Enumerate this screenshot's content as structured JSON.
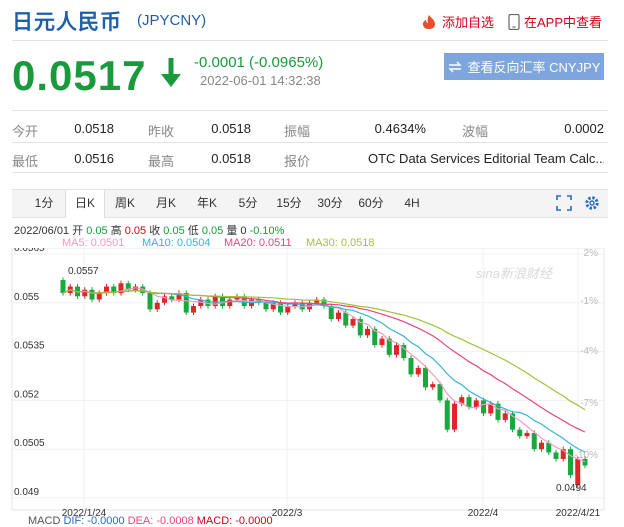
{
  "header": {
    "title": "日元人民币",
    "code": "(JPYCNY)",
    "favorite_label": "添加自选",
    "app_label": "在APP中查看"
  },
  "quote": {
    "price": "0.0517",
    "change": "-0.0001 (-0.0965%)",
    "datetime": "2022-06-01 14:32:38",
    "reverse_button": "查看反向汇率 CNYJPY"
  },
  "stats": [
    {
      "label": "今开",
      "value": "0.0518"
    },
    {
      "label": "昨收",
      "value": "0.0518"
    },
    {
      "label": "振幅",
      "value": "0.4634%"
    },
    {
      "label": "波幅",
      "value": "0.0002"
    },
    {
      "label": "最低",
      "value": "0.0516"
    },
    {
      "label": "最高",
      "value": "0.0518"
    },
    {
      "label": "报价",
      "value": "OTC Data Services Editorial Team Calc..."
    }
  ],
  "tabs": [
    "1分",
    "日K",
    "周K",
    "月K",
    "年K",
    "5分",
    "15分",
    "30分",
    "60分",
    "4H"
  ],
  "active_tab": "日K",
  "bar_info": {
    "date": "2022/06/01",
    "open_label": "开",
    "open": "0.05",
    "high_label": "高",
    "high": "0.05",
    "close_label": "收",
    "close": "0.05",
    "low_label": "低",
    "low": "0.05",
    "volume_label": "量",
    "volume": "0",
    "pct": "-0.10%"
  },
  "ma_legend": [
    {
      "label": "MA5: 0.0501",
      "color": "#f29ac3"
    },
    {
      "label": "MA10: 0.0504",
      "color": "#3ab3d9"
    },
    {
      "label": "MA20: 0.0511",
      "color": "#e6467d"
    },
    {
      "label": "MA30: 0.0518",
      "color": "#a3c23c"
    }
  ],
  "chart_data": {
    "type": "candlestick",
    "y_left_ticks": [
      "0.0565",
      "0.055",
      "0.0535",
      "0.052",
      "0.0505",
      "0.049"
    ],
    "y_right_ticks": [
      "2%",
      "-1%",
      "-4%",
      "-7%",
      "-10%"
    ],
    "x_ticks": [
      "2022/1/24",
      "2022/3",
      "2022/4",
      "2022/4/21"
    ],
    "ylim": [
      0.049,
      0.0565
    ],
    "max_label": "0.0557",
    "min_label": "0.0494",
    "watermark": "sina新浪财经",
    "colors": {
      "up": "#e0262a",
      "down": "#19a83e"
    },
    "candles": [
      [
        0.0557,
        0.0553
      ],
      [
        0.0553,
        0.0555
      ],
      [
        0.0555,
        0.0552
      ],
      [
        0.0552,
        0.0554
      ],
      [
        0.0554,
        0.0551
      ],
      [
        0.0551,
        0.0553
      ],
      [
        0.0553,
        0.0555
      ],
      [
        0.0555,
        0.0553
      ],
      [
        0.0553,
        0.0556
      ],
      [
        0.0556,
        0.0554
      ],
      [
        0.0554,
        0.0555
      ],
      [
        0.0555,
        0.0553
      ],
      [
        0.0553,
        0.0548
      ],
      [
        0.0548,
        0.055
      ],
      [
        0.055,
        0.0552
      ],
      [
        0.0552,
        0.0551
      ],
      [
        0.0551,
        0.0553
      ],
      [
        0.0553,
        0.0547
      ],
      [
        0.0547,
        0.0549
      ],
      [
        0.0549,
        0.0551
      ],
      [
        0.0551,
        0.0549
      ],
      [
        0.0549,
        0.0552
      ],
      [
        0.0552,
        0.0549
      ],
      [
        0.0549,
        0.0551
      ],
      [
        0.0551,
        0.0552
      ],
      [
        0.0552,
        0.0549
      ],
      [
        0.0549,
        0.0551
      ],
      [
        0.0551,
        0.055
      ],
      [
        0.055,
        0.0548
      ],
      [
        0.0548,
        0.055
      ],
      [
        0.055,
        0.0547
      ],
      [
        0.0547,
        0.0549
      ],
      [
        0.0549,
        0.055
      ],
      [
        0.055,
        0.0548
      ],
      [
        0.0548,
        0.055
      ],
      [
        0.055,
        0.0551
      ],
      [
        0.0551,
        0.0549
      ],
      [
        0.0549,
        0.0545
      ],
      [
        0.0545,
        0.0547
      ],
      [
        0.0547,
        0.0543
      ],
      [
        0.0543,
        0.0545
      ],
      [
        0.0545,
        0.054
      ],
      [
        0.054,
        0.0542
      ],
      [
        0.0542,
        0.0537
      ],
      [
        0.0537,
        0.0539
      ],
      [
        0.0539,
        0.0534
      ],
      [
        0.0534,
        0.0537
      ],
      [
        0.0537,
        0.0533
      ],
      [
        0.0533,
        0.0528
      ],
      [
        0.0528,
        0.053
      ],
      [
        0.053,
        0.0524
      ],
      [
        0.0524,
        0.0525
      ],
      [
        0.0525,
        0.052
      ],
      [
        0.052,
        0.0511
      ],
      [
        0.0511,
        0.0519
      ],
      [
        0.0519,
        0.0521
      ],
      [
        0.0521,
        0.0518
      ],
      [
        0.0518,
        0.052
      ],
      [
        0.052,
        0.0516
      ],
      [
        0.0516,
        0.0519
      ],
      [
        0.0519,
        0.0514
      ],
      [
        0.0514,
        0.0516
      ],
      [
        0.0516,
        0.0511
      ],
      [
        0.0511,
        0.0509
      ],
      [
        0.0509,
        0.051
      ],
      [
        0.051,
        0.0505
      ],
      [
        0.0505,
        0.0507
      ],
      [
        0.0507,
        0.0504
      ],
      [
        0.0504,
        0.0502
      ],
      [
        0.0502,
        0.0505
      ],
      [
        0.0505,
        0.0497
      ],
      [
        0.0494,
        0.0502
      ],
      [
        0.0502,
        0.05
      ]
    ]
  },
  "indicator_row": {
    "macd": "MACD",
    "dif": "DIF: -0.0000",
    "dea": "DEA: -0.0008",
    "macd_val": "MACD: -0.0000"
  }
}
